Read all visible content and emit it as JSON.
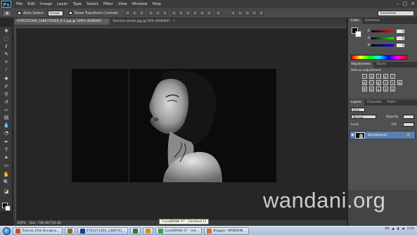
{
  "app": {
    "logo": "Ps",
    "menu": [
      "File",
      "Edit",
      "Image",
      "Layer",
      "Type",
      "Select",
      "Filter",
      "View",
      "Window",
      "Help"
    ],
    "window_controls": [
      "–",
      "□",
      "×"
    ]
  },
  "options_bar": {
    "auto_select_label": "Auto-Select:",
    "auto_select_value": "Group",
    "transform_label": "Show Transform Controls",
    "workspace": "Essentials"
  },
  "tabs": [
    {
      "label": "0705371300_1480741620_6-1.jpg @ 100% (RGB/8#)",
      "active": true
    },
    {
      "label": "Dominic-photo.jpg @ 50% (RGB/8#)",
      "active": false
    }
  ],
  "status": {
    "zoom": "100%",
    "doc_size": "Doc: 736.4K/736.4K"
  },
  "panels": {
    "color": {
      "tabs": [
        "Color",
        "Swatches"
      ],
      "channels": [
        {
          "label": "R",
          "value": "0",
          "color": "#e03c3c"
        },
        {
          "label": "G",
          "value": "0",
          "color": "#3cbf3c"
        },
        {
          "label": "B",
          "value": "0",
          "color": "#3c6ae0"
        }
      ]
    },
    "adjustments": {
      "tabs": [
        "Adjustments",
        "Styles"
      ],
      "title": "Add an adjustment"
    },
    "layers": {
      "tabs": [
        "Layers",
        "Channels",
        "Paths"
      ],
      "kind": "Kind",
      "blend_mode": "Normal",
      "opacity_label": "Opacity:",
      "fill_label": "Fill:",
      "lock_label": "Lock:",
      "layer_name": "Background"
    }
  },
  "tooltip": "CorelDRAW X7 - [Untitled-1]",
  "taskbar": {
    "items": [
      {
        "label": "Tutorial_Efek Bungkus...",
        "color": "#d14b2b",
        "active": false
      },
      {
        "label": "",
        "color": "#8a6b2a",
        "active": false
      },
      {
        "label": "0705371300_1480741...",
        "color": "#1c3f7a",
        "active": true
      },
      {
        "label": "",
        "color": "#2f7a3a",
        "active": false
      },
      {
        "label": "",
        "color": "#e08a1a",
        "active": false
      },
      {
        "label": "CorelDRAW X7 - Unt...",
        "color": "#3aa04a",
        "active": false
      },
      {
        "label": "Blogger: WANDANI...",
        "color": "#e06a1a",
        "active": false
      }
    ],
    "language": "EN",
    "time": "2:50"
  },
  "watermark": "wandani.org"
}
